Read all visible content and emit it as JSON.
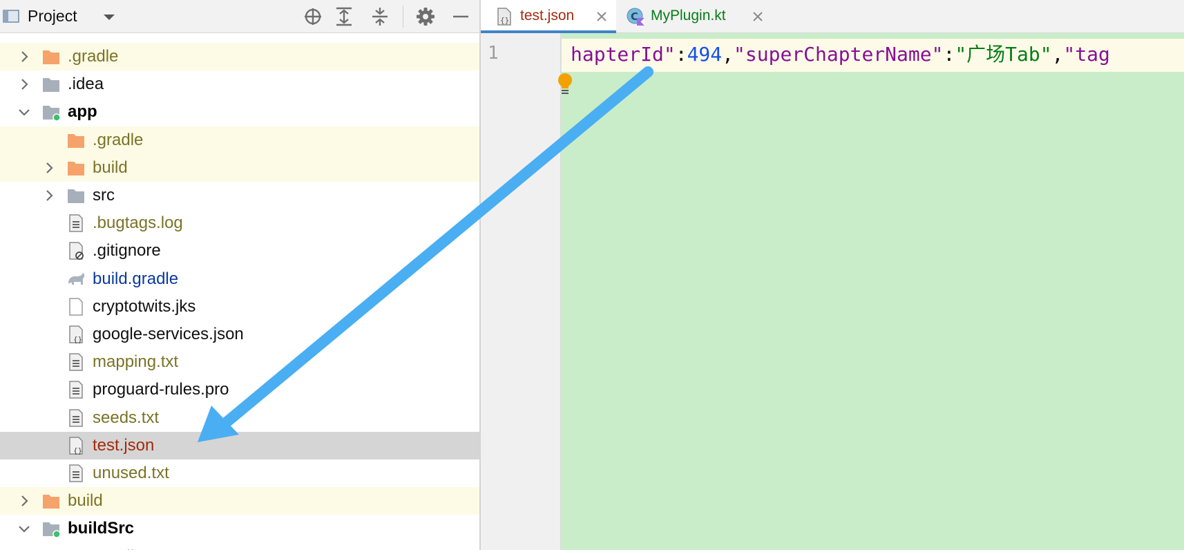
{
  "project_panel": {
    "title": "Project"
  },
  "tree": [
    {
      "label": ".gradle",
      "style": "olive",
      "icon": "folder-orange-icon",
      "arrow": "right"
    },
    {
      "label": ".idea",
      "style": "normal",
      "icon": "folder-gray-icon",
      "arrow": "right"
    },
    {
      "label": "app",
      "style": "bold",
      "icon": "module-folder-icon",
      "arrow": "down"
    },
    {
      "label": ".gradle",
      "style": "olive",
      "icon": "folder-orange-icon",
      "arrow": "none"
    },
    {
      "label": "build",
      "style": "olive",
      "icon": "folder-orange-icon",
      "arrow": "right"
    },
    {
      "label": "src",
      "style": "normal",
      "icon": "folder-gray-icon",
      "arrow": "right"
    },
    {
      "label": ".bugtags.log",
      "style": "olive",
      "icon": "text-file-icon",
      "arrow": "none"
    },
    {
      "label": ".gitignore",
      "style": "normal",
      "icon": "ignore-file-icon",
      "arrow": "none"
    },
    {
      "label": "build.gradle",
      "style": "blue",
      "icon": "gradle-icon",
      "arrow": "none"
    },
    {
      "label": "cryptotwits.jks",
      "style": "normal",
      "icon": "blank-file-icon",
      "arrow": "none"
    },
    {
      "label": "google-services.json",
      "style": "normal",
      "icon": "json-file-icon",
      "arrow": "none"
    },
    {
      "label": "mapping.txt",
      "style": "olive",
      "icon": "text-file-icon",
      "arrow": "none"
    },
    {
      "label": "proguard-rules.pro",
      "style": "normal",
      "icon": "text-file-icon",
      "arrow": "none"
    },
    {
      "label": "seeds.txt",
      "style": "olive",
      "icon": "text-file-icon",
      "arrow": "none"
    },
    {
      "label": "test.json",
      "style": "red",
      "icon": "json-file-icon",
      "arrow": "none"
    },
    {
      "label": "unused.txt",
      "style": "olive",
      "icon": "text-file-icon",
      "arrow": "none"
    },
    {
      "label": "build",
      "style": "olive",
      "icon": "folder-orange-icon",
      "arrow": "right"
    },
    {
      "label": "buildSrc",
      "style": "bold",
      "icon": "module-folder-icon",
      "arrow": "down"
    },
    {
      "label": ".gradle",
      "style": "olive",
      "icon": "folder-orange-icon",
      "arrow": "right"
    }
  ],
  "tabs": [
    {
      "label": "test.json",
      "color": "#a32b0c",
      "icon": "json-file-icon",
      "active": true
    },
    {
      "label": "MyPlugin.kt",
      "color": "#067d17",
      "icon": "kotlin-class-icon",
      "active": false
    }
  ],
  "editor": {
    "line_number": "1",
    "tokens": [
      {
        "text": "hapterId\"",
        "cls": "k"
      },
      {
        "text": ":",
        "cls": "p"
      },
      {
        "text": "494",
        "cls": "n"
      },
      {
        "text": ",",
        "cls": "p"
      },
      {
        "text": "\"superChapterName\"",
        "cls": "k"
      },
      {
        "text": ":",
        "cls": "p"
      },
      {
        "text": "\"广场Tab\"",
        "cls": "s"
      },
      {
        "text": ",",
        "cls": "p"
      },
      {
        "text": "\"tag",
        "cls": "k"
      }
    ]
  },
  "colors": {
    "editor_bg": "#c9edc9",
    "current_line": "#fdfbe8",
    "tab_accent": "#4083c9",
    "annotation_arrow": "#4aaef2"
  }
}
